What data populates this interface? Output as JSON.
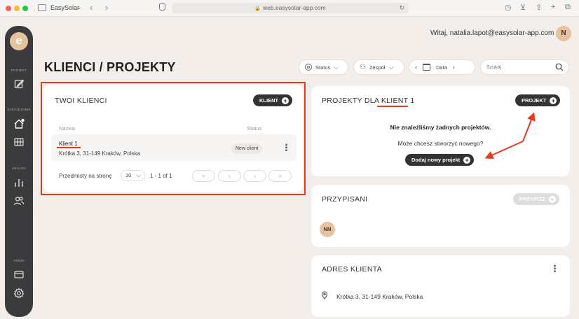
{
  "browser": {
    "app_label": "EasySolar",
    "url": "web.easysolar-app.com"
  },
  "sidebar": {
    "logo": "e",
    "sections": [
      "PROJEKT",
      "ZARZĄDZANIE",
      "ANALIZA",
      "ADMIN"
    ]
  },
  "header": {
    "welcome": "Witaj, natalia.lapot@easysolar-app.com",
    "avatar_initial": "N",
    "title": "KLIENCI / PROJEKTY"
  },
  "filters": {
    "status_label": "Status",
    "team_label": "Zespół",
    "date_label": "Data",
    "search_placeholder": "Szukaj"
  },
  "clients_card": {
    "title": "TWOI KLIENCI",
    "add_button": "KLIENT",
    "columns": [
      "Nazwa",
      "Status"
    ],
    "rows": [
      {
        "name": "Klient 1",
        "address": "Krótka 3, 31-149 Kraków, Polska",
        "status": "New client"
      }
    ],
    "pagination": {
      "items_per_page_label": "Przedmioty na stronę",
      "page_size": "10",
      "range": "1 - 1 of 1",
      "first": "«",
      "prev": "‹",
      "next": "›",
      "last": "»"
    }
  },
  "projects_card": {
    "title_prefix": "PROJEKTY DLA",
    "title_client": "KLIENT 1",
    "add_button": "PROJEKT",
    "empty_title": "Nie znaleźliśmy żadnych projektów.",
    "empty_subtitle": "Może chcesz stworzyć nowego?",
    "create_button": "Dodaj nowy projekt"
  },
  "assigned_card": {
    "title": "PRZYPISANI",
    "assign_button": "PRZYPISZ",
    "member_initials": "NN"
  },
  "address_card": {
    "title": "ADRES KLIENTA",
    "address": "Krótka 3, 31-149 Kraków, Polska"
  },
  "colors": {
    "accent_red": "#e23b1e",
    "dark": "#333333",
    "sidebar": "#3b3a3d",
    "logo": "#e5c39f"
  }
}
